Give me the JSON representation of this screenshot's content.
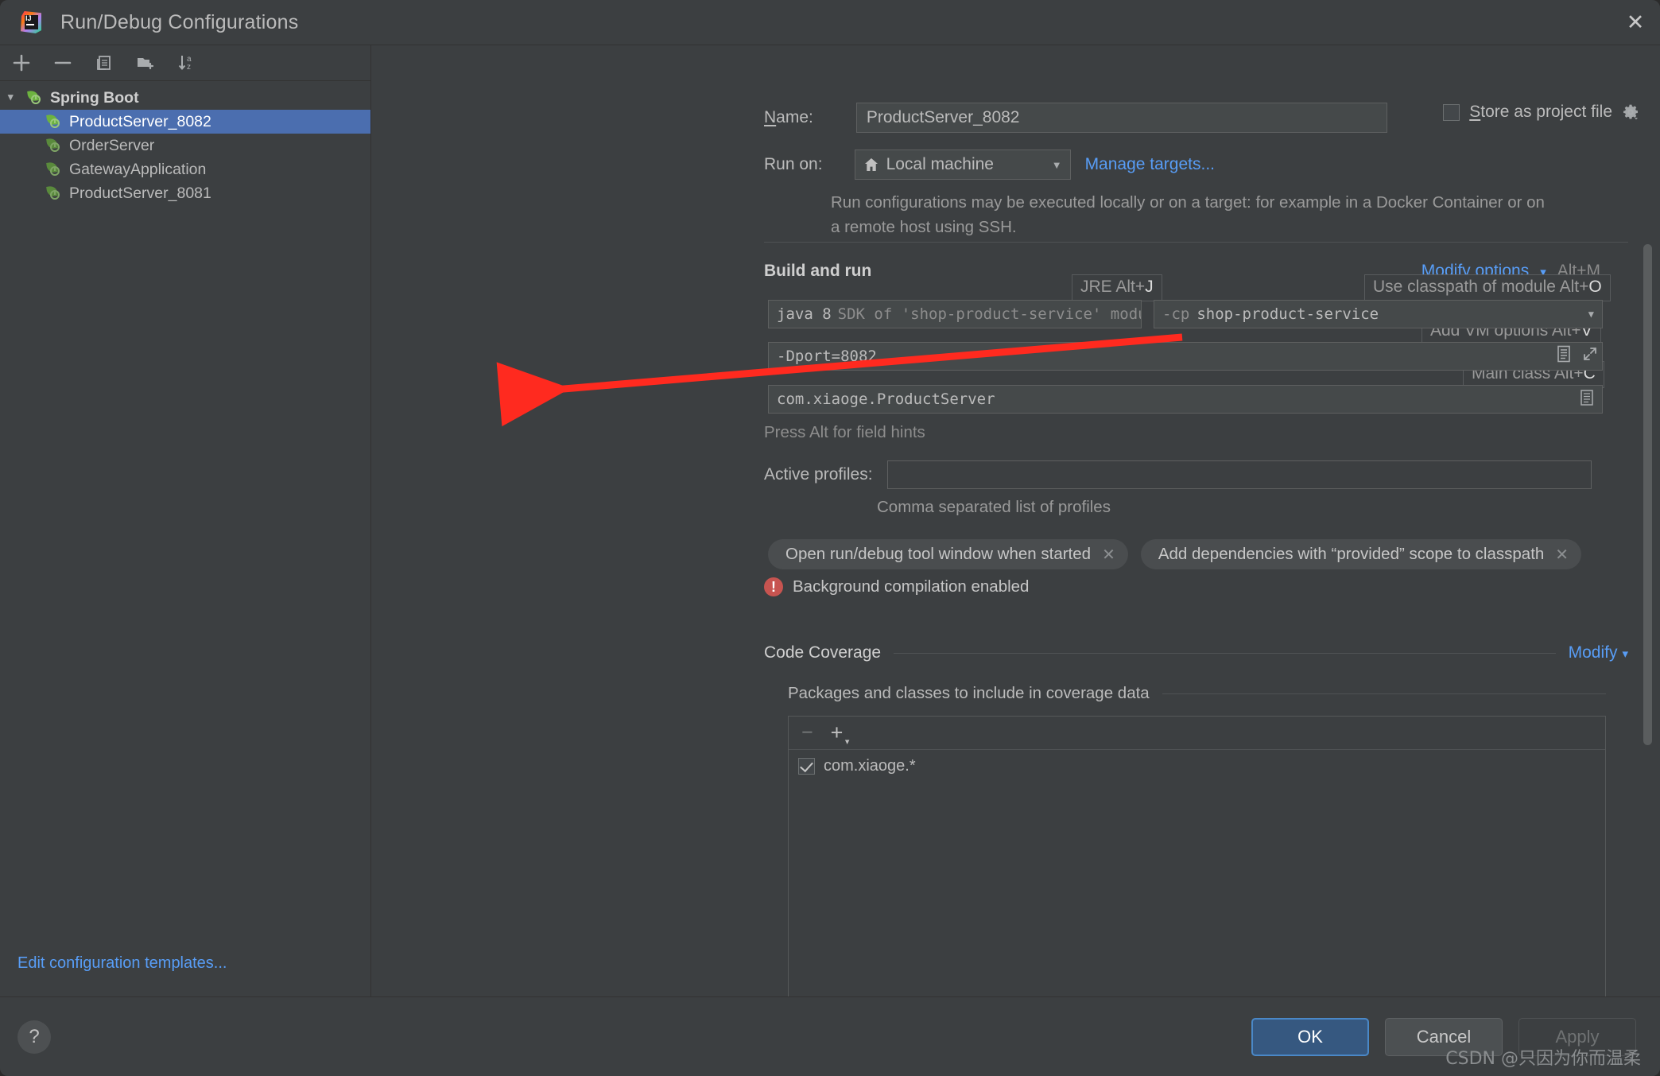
{
  "window": {
    "title": "Run/Debug Configurations",
    "logo_icon": "intellij-idea-logo",
    "close_icon": "close-icon"
  },
  "sidebar": {
    "toolbar": [
      {
        "name": "add",
        "icon": "plus-icon"
      },
      {
        "name": "remove",
        "icon": "minus-icon"
      },
      {
        "name": "copy",
        "icon": "copy-icon"
      },
      {
        "name": "new-folder",
        "icon": "folder-add-icon"
      },
      {
        "name": "sort",
        "icon": "sort-alpha-icon"
      }
    ],
    "tree": [
      {
        "label": "Spring Boot",
        "level": 0,
        "expanded": true,
        "selected": false
      },
      {
        "label": "ProductServer_8082",
        "level": 1,
        "selected": true
      },
      {
        "label": "OrderServer",
        "level": 1,
        "selected": false
      },
      {
        "label": "GatewayApplication",
        "level": 1,
        "selected": false
      },
      {
        "label": "ProductServer_8081",
        "level": 1,
        "selected": false
      }
    ],
    "edit_templates_link": "Edit configuration templates..."
  },
  "form": {
    "name_label": "Name:",
    "name_label_mnemonic": "N",
    "name_value": "ProductServer_8082",
    "store_as_project_file_label": "Store as project file",
    "store_as_project_file_mnemonic": "S",
    "store_as_project_file_checked": false,
    "run_on_label": "Run on:",
    "run_on_value": "Local machine",
    "manage_targets_link": "Manage targets...",
    "description": "Run configurations may be executed locally or on a target: for example in a Docker Container or on a remote host using SSH."
  },
  "build_and_run": {
    "title": "Build and run",
    "modify_options_label": "Modify options",
    "modify_options_shortcut": "Alt+M",
    "hints": {
      "jre": {
        "text": "JRE Alt+",
        "key": "J"
      },
      "classpath": {
        "text": "Use classpath of module Alt+",
        "key": "O"
      },
      "vm_options": {
        "text": "Add VM options Alt+",
        "key": "V"
      },
      "main_class": {
        "text": "Main class Alt+",
        "key": "C"
      }
    },
    "sdk_value": "java 8",
    "sdk_detail": "SDK of 'shop-product-service' modu",
    "classpath_prefix": "-cp",
    "classpath_value": "shop-product-service",
    "vm_options_value": "-Dport=8082",
    "main_class_value": "com.xiaoge.ProductServer",
    "field_hints_text": "Press Alt for field hints"
  },
  "profiles": {
    "label": "Active profiles:",
    "value": "",
    "placeholder": "",
    "sub_text": "Comma separated list of profiles"
  },
  "chips": [
    {
      "label": "Open run/debug tool window when started",
      "close_icon": "chip-close-icon"
    },
    {
      "label": "Add dependencies with “provided” scope to classpath",
      "close_icon": "chip-close-icon"
    }
  ],
  "warning": {
    "icon": "error-circle-icon",
    "text": "Background compilation enabled"
  },
  "code_coverage": {
    "title": "Code Coverage",
    "modify_label": "Modify",
    "packages_title": "Packages and classes to include in coverage data",
    "toolbar": [
      {
        "name": "remove-package",
        "icon": "minus-icon"
      },
      {
        "name": "add-package",
        "icon": "plus-dropdown-icon"
      }
    ],
    "items": [
      {
        "label": "com.xiaoge.*",
        "checked": true
      }
    ]
  },
  "footer": {
    "help_icon": "help-question-icon",
    "ok_label": "OK",
    "cancel_label": "Cancel",
    "apply_label": "Apply",
    "apply_disabled": true
  },
  "watermark": "CSDN @只因为你而温柔",
  "annotation": {
    "type": "red-arrow",
    "points_to": "-Dport=8082",
    "color": "#ff2a1f"
  }
}
